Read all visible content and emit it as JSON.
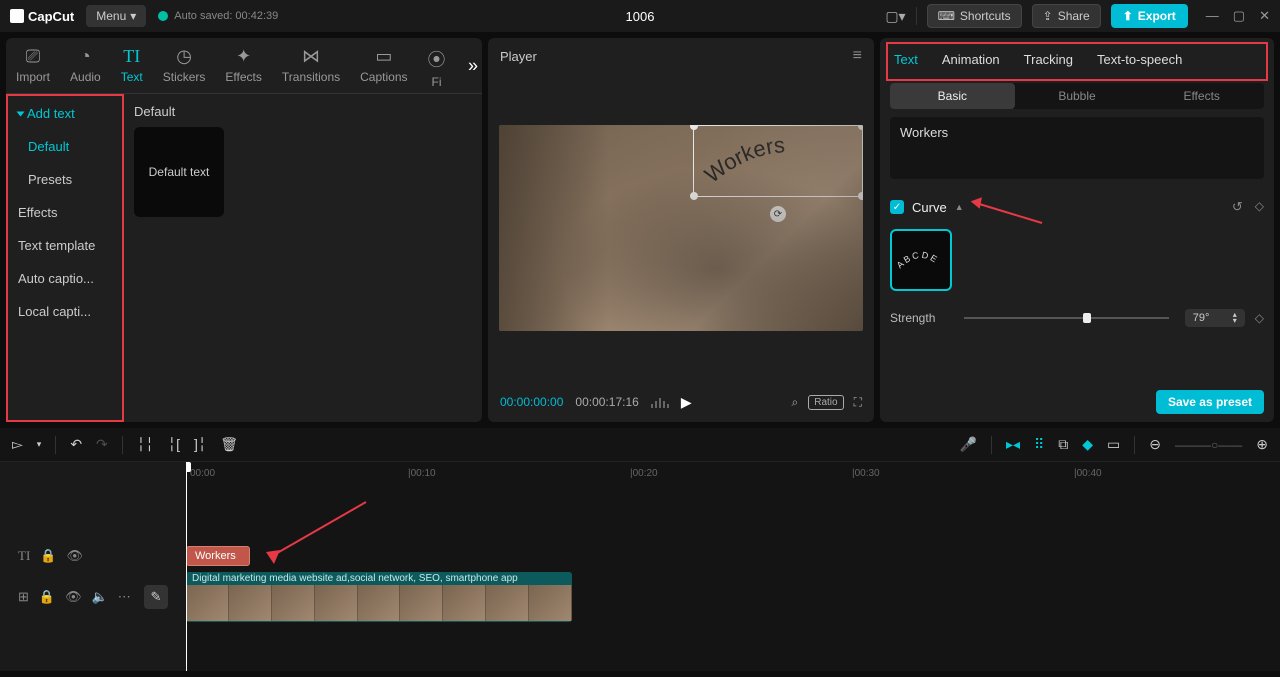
{
  "topbar": {
    "app_name": "CapCut",
    "menu_label": "Menu",
    "autosave": "Auto saved: 00:42:39",
    "project_title": "1006",
    "shortcuts": "Shortcuts",
    "share": "Share",
    "export": "Export"
  },
  "media_tabs": [
    {
      "icon": "⧉",
      "label": "Import"
    },
    {
      "icon": "◔",
      "label": "Audio"
    },
    {
      "icon": "TI",
      "label": "Text"
    },
    {
      "icon": "◷",
      "label": "Stickers"
    },
    {
      "icon": "✦",
      "label": "Effects"
    },
    {
      "icon": "⋈",
      "label": "Transitions"
    },
    {
      "icon": "▭",
      "label": "Captions"
    },
    {
      "icon": "",
      "label": "Fi"
    }
  ],
  "sidebar": {
    "header": "Add text",
    "items": [
      "Default",
      "Presets",
      "Effects",
      "Text template",
      "Auto captio...",
      "Local capti..."
    ]
  },
  "content": {
    "section_label": "Default",
    "tile_label": "Default text"
  },
  "player": {
    "title": "Player",
    "current_tc": "00:00:00:00",
    "duration_tc": "00:00:17:16",
    "overlay_text": "Workers",
    "ratio": "Ratio"
  },
  "inspector": {
    "tabs": [
      "Text",
      "Animation",
      "Tracking",
      "Text-to-speech"
    ],
    "sub_tabs": [
      "Basic",
      "Bubble",
      "Effects"
    ],
    "text_value": "Workers",
    "curve_label": "Curve",
    "curve_preset_label": "ABCDE",
    "strength_label": "Strength",
    "angle_value": "79°",
    "save_preset": "Save as preset"
  },
  "timeline": {
    "ruler": [
      "00:00",
      "|00:10",
      "|00:20",
      "|00:30",
      "|00:40"
    ],
    "text_clip_label": "Workers",
    "video_clip_title": "Digital marketing media website ad,social network, SEO, smartphone app"
  }
}
